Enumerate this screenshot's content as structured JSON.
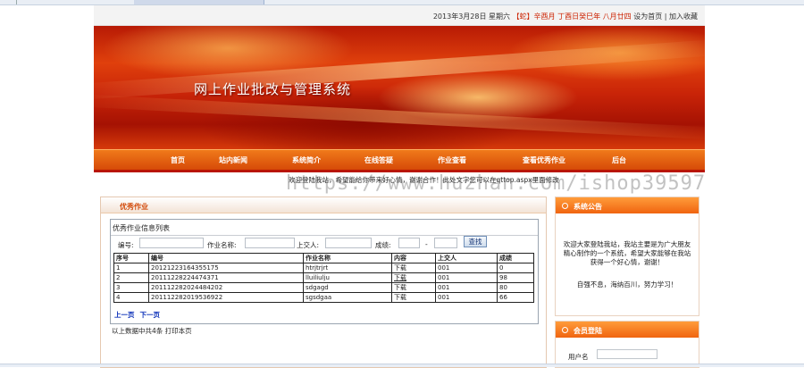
{
  "topbar": {
    "date": "2013年3月28日 星期六",
    "lunar": "【蛇】辛酉月 丁酉日癸巳年 八月廿四",
    "set_home": "设为首页",
    "separator": "|",
    "add_fav": "加入收藏"
  },
  "banner": {
    "title": "网上作业批改与管理系统"
  },
  "nav": {
    "items": [
      "首页",
      "站内新闻",
      "系统简介",
      "在线答疑",
      "作业查看",
      "查看优秀作业",
      "后台"
    ]
  },
  "marquee": {
    "text": "欢迎登陆我站，希望能给你带来好心情，谢谢合作！此处文字您可以在qttop.aspx里面修改"
  },
  "watermark": "https://www.huzhan.com/ishop39597",
  "excellent": {
    "heading": "优秀作业",
    "box_title": "优秀作业信息列表",
    "filter": {
      "no_label": "编号:",
      "name_label": "作业名称:",
      "submitter_label": "上交人:",
      "score_label": "成绩:",
      "dash": "-",
      "search_button": "查找"
    },
    "columns": [
      "序号",
      "编号",
      "作业名称",
      "内容",
      "上交人",
      "成绩"
    ],
    "rows": [
      {
        "seq": "1",
        "no": "20121223164355175",
        "name": "htrjtrjrt",
        "content": "下载",
        "submitter": "001",
        "score": "0"
      },
      {
        "seq": "2",
        "no": "20111228224474371",
        "name": "lluiliulju",
        "content": "下载",
        "submitter": "001",
        "score": "98"
      },
      {
        "seq": "3",
        "no": "20111228202448420​2",
        "name": "sdgagd",
        "content": "下载",
        "submitter": "001",
        "score": "80"
      },
      {
        "seq": "4",
        "no": "20111228201953692​2",
        "name": "sgsdgaa",
        "content": "下载",
        "submitter": "001",
        "score": "66"
      }
    ],
    "prev_page": "上一页",
    "next_page": "下一页",
    "summary": "以上数据中共4条  打印本页"
  },
  "sidebar": {
    "notice": {
      "title": "系统公告",
      "body": "欢迎大家登陆我站，我站主要是为广大朋友精心制作的一个系统，希望大家能够在我站获得一个好心情，谢谢！",
      "motto": "自强不息，海纳百川，努力学习！"
    },
    "login": {
      "title": "会员登陆",
      "username_label": "用户名"
    }
  },
  "colors": {
    "accent": "#f06410",
    "nav": "#e05a10",
    "banner": "#c92408",
    "link": "#0a2fb8"
  }
}
